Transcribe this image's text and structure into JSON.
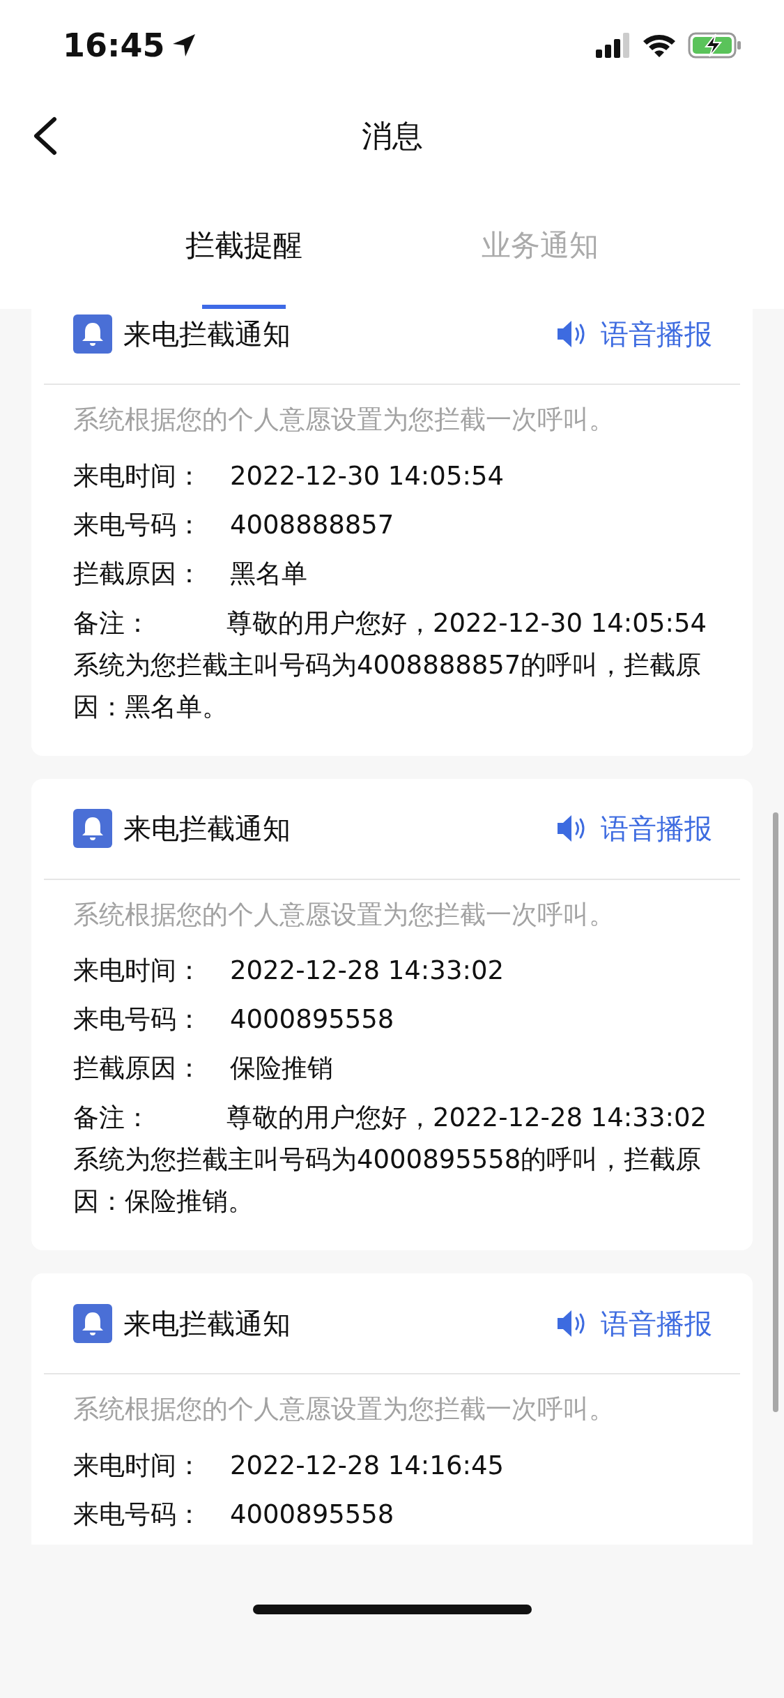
{
  "status_bar": {
    "time": "16:45"
  },
  "header": {
    "title": "消息"
  },
  "tabs": [
    {
      "label": "拦截提醒",
      "selected": true
    },
    {
      "label": "业务通知",
      "selected": false
    }
  ],
  "cards": [
    {
      "title": "来电拦截通知",
      "action": "语音播报",
      "description": "系统根据您的个人意愿设置为您拦截一次呼叫。",
      "fields": [
        {
          "label": "来电时间：",
          "value": "2022-12-30 14:05:54"
        },
        {
          "label": "来电号码：",
          "value": "4008888857"
        },
        {
          "label": "拦截原因：",
          "value": "黑名单"
        }
      ],
      "remark": {
        "label": "备注：",
        "value": "尊敬的用户您好，2022-12-30 14:05:54 系统为您拦截主叫号码为4008888857的呼叫，拦截原因：黑名单。"
      }
    },
    {
      "title": "来电拦截通知",
      "action": "语音播报",
      "description": "系统根据您的个人意愿设置为您拦截一次呼叫。",
      "fields": [
        {
          "label": "来电时间：",
          "value": "2022-12-28 14:33:02"
        },
        {
          "label": "来电号码：",
          "value": "4000895558"
        },
        {
          "label": "拦截原因：",
          "value": "保险推销"
        }
      ],
      "remark": {
        "label": "备注：",
        "value": "尊敬的用户您好，2022-12-28 14:33:02 系统为您拦截主叫号码为4000895558的呼叫，拦截原因：保险推销。"
      }
    },
    {
      "title": "来电拦截通知",
      "action": "语音播报",
      "description": "系统根据您的个人意愿设置为您拦截一次呼叫。",
      "fields": [
        {
          "label": "来电时间：",
          "value": "2022-12-28 14:16:45"
        },
        {
          "label": "来电号码：",
          "value": "4000895558"
        }
      ]
    }
  ]
}
